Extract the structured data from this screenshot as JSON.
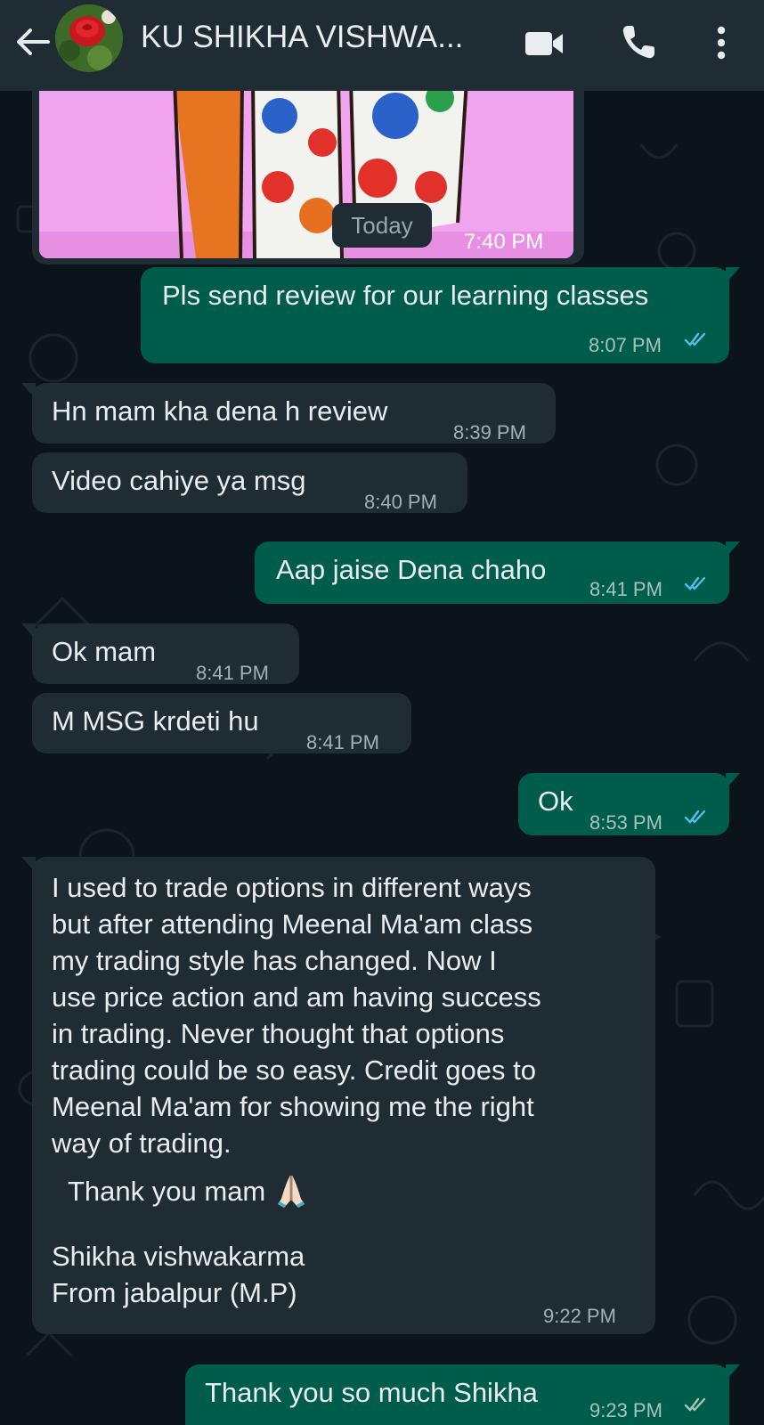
{
  "header": {
    "contact_name": "KU SHIKHA VISHWA...",
    "icons": [
      "back-arrow-icon",
      "video-call-icon",
      "voice-call-icon",
      "more-options-icon"
    ]
  },
  "chat": {
    "date_divider": "Today",
    "image_message": {
      "time": "7:40 PM",
      "direction": "incoming"
    },
    "messages": [
      {
        "dir": "out",
        "text": "Pls send review for our learning classes",
        "time": "8:07 PM",
        "status": "read"
      },
      {
        "dir": "in",
        "text": "Hn mam kha dena h review",
        "time": "8:39 PM"
      },
      {
        "dir": "in",
        "text": "Video cahiye ya msg",
        "time": "8:40 PM"
      },
      {
        "dir": "out",
        "text": "Aap jaise Dena chaho",
        "time": "8:41 PM",
        "status": "read"
      },
      {
        "dir": "in",
        "text": "Ok mam",
        "time": "8:41 PM"
      },
      {
        "dir": "in",
        "text": "M MSG krdeti hu",
        "time": "8:41 PM"
      },
      {
        "dir": "out",
        "text": "Ok",
        "time": "8:53 PM",
        "status": "read"
      },
      {
        "dir": "out",
        "text": "Thank you so much Shikha",
        "time": "9:23 PM",
        "status": "sent"
      }
    ],
    "review_message": {
      "dir": "in",
      "lines": [
        "I used to trade options in different ways",
        "but after attending Meenal Ma'am class",
        "my trading style has changed. Now I",
        "use price action and am having success",
        "in trading. Never thought that options",
        "trading could be so easy. Credit goes to",
        "Meenal Ma'am for showing me the right",
        "way of trading."
      ],
      "thanks_line": "Thank you mam",
      "emoji": "folded-hands-emoji",
      "signature_lines": [
        "Shikha vishwakarma",
        "From jabalpur (M.P)"
      ],
      "time": "9:22 PM"
    }
  },
  "colors": {
    "header_bg": "#1f2c34",
    "chat_bg": "#0b141a",
    "incoming_bubble": "#1f2c34",
    "outgoing_bubble": "#005c4b",
    "read_tick": "#53bdeb"
  }
}
